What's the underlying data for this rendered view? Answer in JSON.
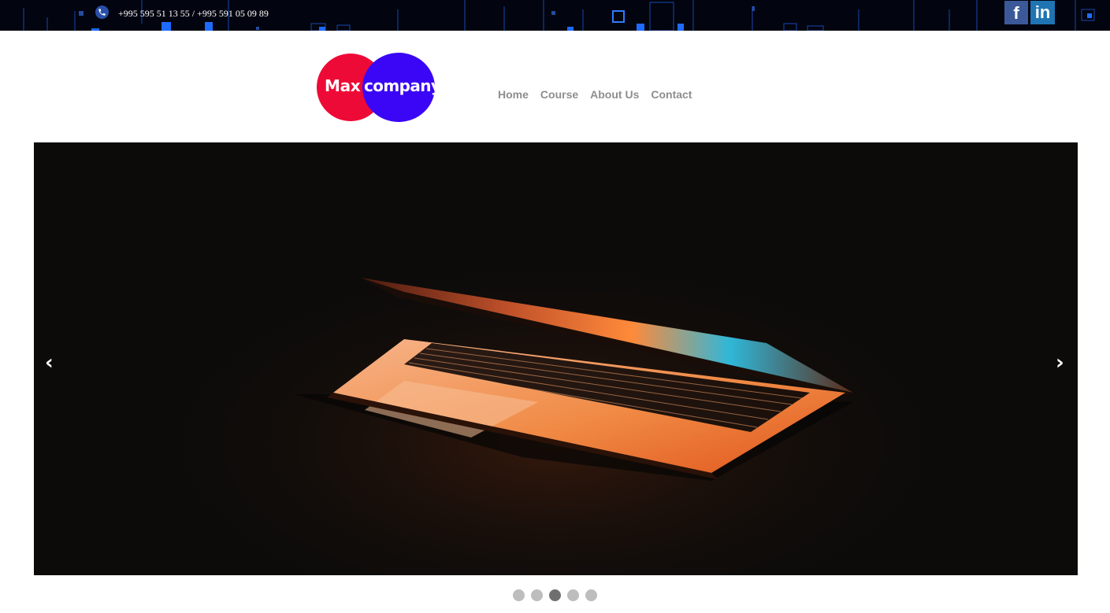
{
  "topbar": {
    "phone_icon": "phone-icon",
    "phone_text": "+995 595 51 13 55 / +995 591 05 09 89",
    "social": [
      {
        "name": "facebook-icon",
        "glyph": "f",
        "color": "#3b5998"
      },
      {
        "name": "linkedin-icon",
        "glyph": "in",
        "color": "#1f74b3"
      }
    ]
  },
  "logo": {
    "word1": "Max",
    "word2": "company",
    "color1": "#ee0a36",
    "color2": "#3a06f5"
  },
  "nav": {
    "items": [
      "Home",
      "Course",
      "About Us",
      "Contact"
    ]
  },
  "slider": {
    "image": "laptop-photo",
    "prev_label": "‹",
    "next_label": "›",
    "slide_count": 5,
    "active_slide": 3
  }
}
